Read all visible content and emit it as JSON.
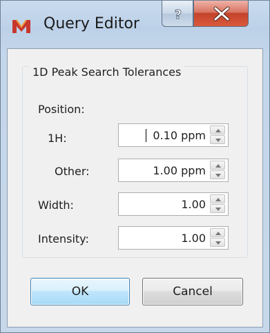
{
  "window": {
    "title": "Query Editor",
    "help_symbol": "?",
    "close_symbol": "x"
  },
  "group": {
    "title": "1D Peak Search Tolerances"
  },
  "fields": {
    "position_label": "Position:",
    "h1_label": "1H:",
    "h1_value": "0.10 ppm",
    "other_label": "Other:",
    "other_value": "1.00 ppm",
    "width_label": "Width:",
    "width_value": "1.00",
    "intensity_label": "Intensity:",
    "intensity_value": "1.00"
  },
  "buttons": {
    "ok_label": "OK",
    "cancel_label": "Cancel"
  },
  "colors": {
    "titlebar": "#bcd1e8",
    "close_button": "#c4432b",
    "app_icon": "#c8372d",
    "ok_border": "#3c7fb1"
  }
}
